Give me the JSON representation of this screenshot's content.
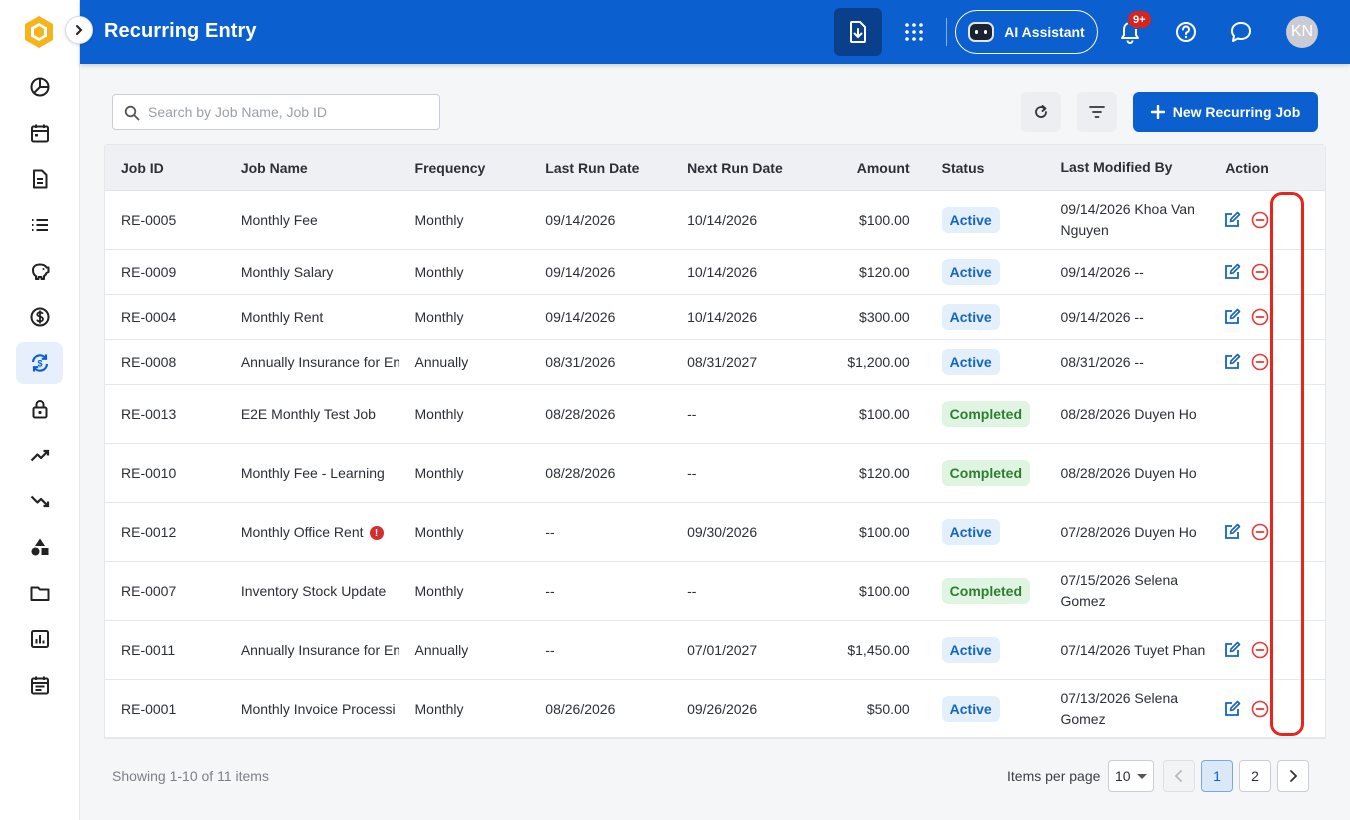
{
  "header": {
    "title": "Recurring Entry",
    "ai_label": "AI Assistant",
    "notification_badge": "9+",
    "avatar_initials": "KN"
  },
  "sidebar": {
    "items": [
      {
        "icon": "dashboard-icon"
      },
      {
        "icon": "calendar-icon"
      },
      {
        "icon": "document-icon"
      },
      {
        "icon": "list-icon"
      },
      {
        "icon": "piggy-bank-icon"
      },
      {
        "icon": "dollar-icon"
      },
      {
        "icon": "recurring-icon",
        "active": true
      },
      {
        "icon": "lock-icon"
      },
      {
        "icon": "trending-up-icon"
      },
      {
        "icon": "trending-down-icon"
      },
      {
        "icon": "shapes-icon"
      },
      {
        "icon": "folder-icon"
      },
      {
        "icon": "report-icon"
      },
      {
        "icon": "schedule-icon"
      }
    ]
  },
  "toolbar": {
    "search_placeholder": "Search by Job Name, Job ID",
    "search_value": "",
    "new_button_label": "New Recurring Job"
  },
  "table": {
    "columns": [
      "Job ID",
      "Job Name",
      "Frequency",
      "Last Run Date",
      "Next Run Date",
      "Amount",
      "Status",
      "Last Modified By",
      "Action"
    ],
    "rows": [
      {
        "id": "RE-0005",
        "name": "Monthly Fee",
        "frequency": "Monthly",
        "last_run": "09/14/2026",
        "next_run": "10/14/2026",
        "amount": "$100.00",
        "status": "Active",
        "modified": "09/14/2026 Khoa Van Nguyen"
      },
      {
        "id": "RE-0009",
        "name": "Monthly Salary",
        "frequency": "Monthly",
        "last_run": "09/14/2026",
        "next_run": "10/14/2026",
        "amount": "$120.00",
        "status": "Active",
        "modified": "09/14/2026 --"
      },
      {
        "id": "RE-0004",
        "name": "Monthly Rent",
        "frequency": "Monthly",
        "last_run": "09/14/2026",
        "next_run": "10/14/2026",
        "amount": "$300.00",
        "status": "Active",
        "modified": "09/14/2026 --"
      },
      {
        "id": "RE-0008",
        "name": "Annually Insurance for Em",
        "frequency": "Annually",
        "last_run": "08/31/2026",
        "next_run": "08/31/2027",
        "amount": "$1,200.00",
        "status": "Active",
        "modified": "08/31/2026 --"
      },
      {
        "id": "RE-0013",
        "name": "E2E Monthly Test Job",
        "frequency": "Monthly",
        "last_run": "08/28/2026",
        "next_run": "--",
        "amount": "$100.00",
        "status": "Completed",
        "modified": "08/28/2026 Duyen Ho"
      },
      {
        "id": "RE-0010",
        "name": "Monthly Fee - Learning",
        "frequency": "Monthly",
        "last_run": "08/28/2026",
        "next_run": "--",
        "amount": "$120.00",
        "status": "Completed",
        "modified": "08/28/2026 Duyen Ho"
      },
      {
        "id": "RE-0012",
        "name": "Monthly Office Rent",
        "frequency": "Monthly",
        "last_run": "--",
        "next_run": "09/30/2026",
        "amount": "$100.00",
        "status": "Active",
        "modified": "07/28/2026 Duyen Ho",
        "warning": "!"
      },
      {
        "id": "RE-0007",
        "name": "Inventory Stock Update",
        "frequency": "Monthly",
        "last_run": "--",
        "next_run": "--",
        "amount": "$100.00",
        "status": "Completed",
        "modified": "07/15/2026 Selena Gomez"
      },
      {
        "id": "RE-0011",
        "name": "Annually Insurance for Em",
        "frequency": "Annually",
        "last_run": "--",
        "next_run": "07/01/2027",
        "amount": "$1,450.00",
        "status": "Active",
        "modified": "07/14/2026 Tuyet Phan"
      },
      {
        "id": "RE-0001",
        "name": "Monthly Invoice Processi",
        "frequency": "Monthly",
        "last_run": "08/26/2026",
        "next_run": "09/26/2026",
        "amount": "$50.00",
        "status": "Active",
        "modified": "07/13/2026 Selena Gomez"
      }
    ]
  },
  "footer": {
    "showing_text": "Showing 1-10 of 11 items",
    "items_per_page_label": "Items per page",
    "items_per_page_value": "10",
    "pages": [
      "1",
      "2"
    ],
    "current_page": "1"
  },
  "colors": {
    "brand": "#0b5fcf",
    "active_pill_bg": "#e3f0fc",
    "completed_pill_bg": "#dff5e1",
    "delete_red": "#e53935",
    "highlight": "#e8251b"
  }
}
